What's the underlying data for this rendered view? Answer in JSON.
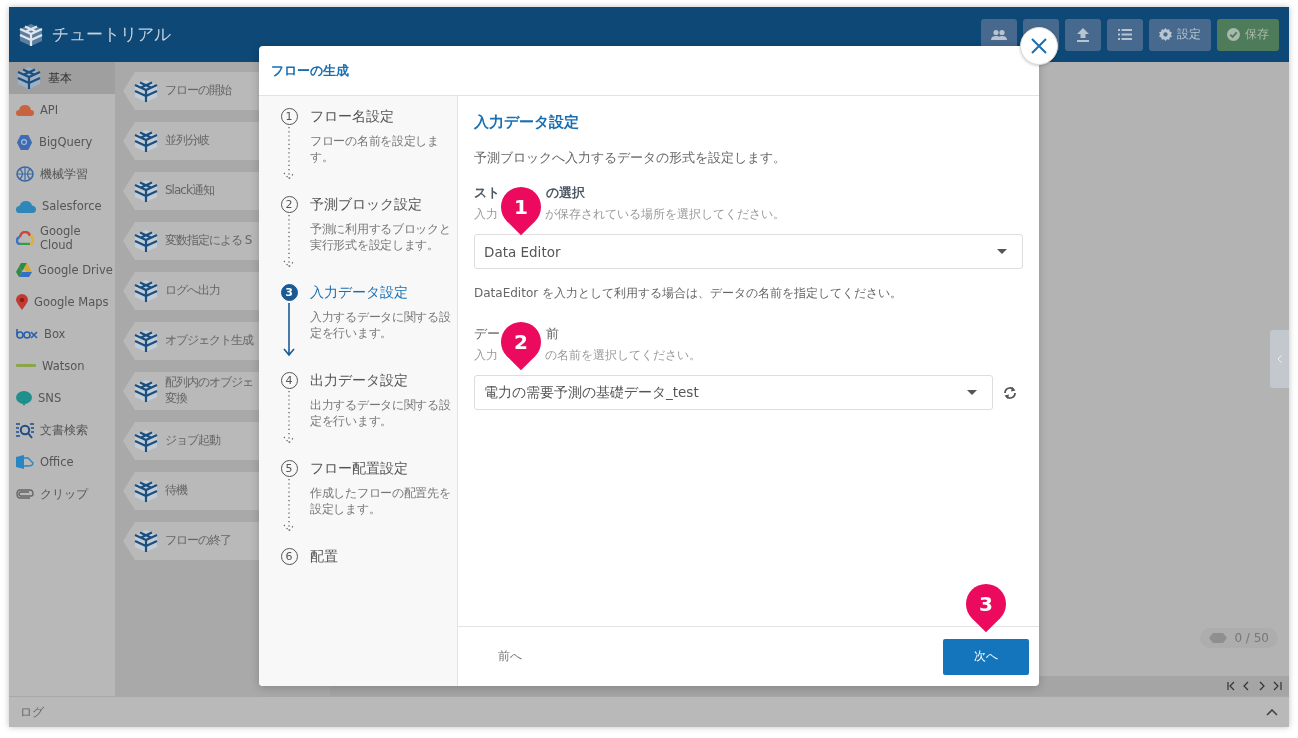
{
  "app": {
    "title": "チュートリアル"
  },
  "header_buttons": [
    {
      "kind": "users"
    },
    {
      "kind": "blank"
    },
    {
      "kind": "upload"
    },
    {
      "kind": "list"
    },
    {
      "kind": "settings",
      "label": "設定"
    },
    {
      "kind": "save",
      "label": "保存"
    }
  ],
  "sidebar": {
    "items": [
      {
        "label": "基本",
        "selected": true
      },
      {
        "label": "API",
        "selected": false
      },
      {
        "label": "BigQuery",
        "selected": false
      },
      {
        "label": "機械学習",
        "selected": false
      },
      {
        "label": "Salesforce",
        "selected": false
      },
      {
        "label": "Google Cloud",
        "selected": false
      },
      {
        "label": "Google Drive",
        "selected": false
      },
      {
        "label": "Google Maps",
        "selected": false
      },
      {
        "label": "Box",
        "selected": false
      },
      {
        "label": "Watson",
        "selected": false
      },
      {
        "label": "SNS",
        "selected": false
      },
      {
        "label": "文書検索",
        "selected": false
      },
      {
        "label": "Office",
        "selected": false
      },
      {
        "label": "クリップ",
        "selected": false
      }
    ]
  },
  "palette": {
    "blocks": [
      "フローの開始",
      "並列分岐",
      "Slack通知",
      "変数指定による S",
      "ログへ出力",
      "オブジェクト生成",
      "配列内のオブジェ変換",
      "ジョブ起動",
      "待機",
      "フローの終了"
    ]
  },
  "canvas": {
    "counter": "0 / 50"
  },
  "log": {
    "title": "ログ"
  },
  "modal": {
    "title": "フローの生成",
    "steps": [
      {
        "number": "1",
        "title": "フロー名設定",
        "description": "フローの名前を設定します。",
        "selected": false
      },
      {
        "number": "2",
        "title": "予測ブロック設定",
        "description": "予測に利用するブロックと実行形式を設定します。",
        "selected": false
      },
      {
        "number": "3",
        "title": "入力データ設定",
        "description": "入力するデータに関する設定を行います。",
        "selected": true
      },
      {
        "number": "4",
        "title": "出力データ設定",
        "description": "出力するデータに関する設定を行います。",
        "selected": false
      },
      {
        "number": "5",
        "title": "フロー配置設定",
        "description": "作成したフローの配置先を設定します。",
        "selected": false
      },
      {
        "number": "6",
        "title": "配置",
        "selected": false
      }
    ],
    "section_title": "入力データ設定",
    "intro": "予測ブロックへ入力するデータの形式を設定します。",
    "storage_field": {
      "label_parts": [
        "スト",
        "の選択"
      ],
      "hint_parts": [
        "入力",
        "が保存されている場所を選択してください。"
      ],
      "value": "Data Editor"
    },
    "note": "DataEditor を入力として利用する場合は、データの名前を指定してください。",
    "data_field": {
      "label_parts": [
        "デー",
        "前"
      ],
      "hint_parts": [
        "入力",
        "の名前を選択してください。"
      ],
      "value": "電力の需要予測の基礎データ_test"
    },
    "back": "前へ",
    "next": "次へ"
  },
  "markers": [
    "1",
    "2",
    "3"
  ]
}
